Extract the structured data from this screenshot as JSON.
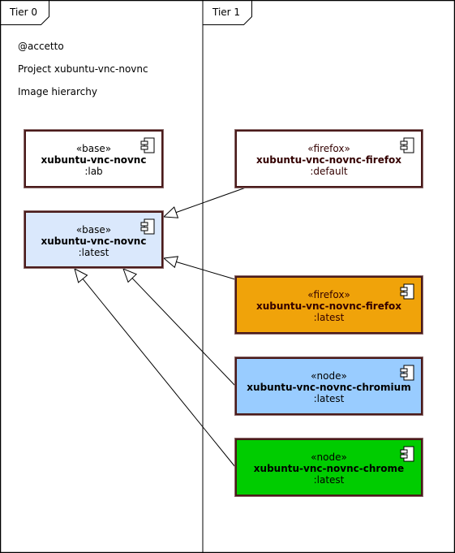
{
  "lanes": [
    {
      "label": "Tier 0"
    },
    {
      "label": "Tier 1"
    }
  ],
  "notes": [
    "@accetto",
    "Project xubuntu-vnc-novnc",
    "Image hierarchy"
  ],
  "components": [
    {
      "id": "base-lab",
      "stereotype": "«base»",
      "name": "xubuntu-vnc-novnc",
      "tag": ":lab",
      "fill": "#ffffff",
      "text_color": "#000000"
    },
    {
      "id": "base-latest",
      "stereotype": "«base»",
      "name": "xubuntu-vnc-novnc",
      "tag": ":latest",
      "fill": "#dae8fc",
      "text_color": "#000000"
    },
    {
      "id": "firefox-default",
      "stereotype": "«firefox»",
      "name": "xubuntu-vnc-novnc-firefox",
      "tag": ":default",
      "fill": "#ffffff",
      "text_color": "#330000"
    },
    {
      "id": "firefox-latest",
      "stereotype": "«firefox»",
      "name": "xubuntu-vnc-novnc-firefox",
      "tag": ":latest",
      "fill": "#f0a30a",
      "text_color": "#330000"
    },
    {
      "id": "chromium-latest",
      "stereotype": "«node»",
      "name": "xubuntu-vnc-novnc-chromium",
      "tag": ":latest",
      "fill": "#99ccff",
      "text_color": "#000000"
    },
    {
      "id": "chrome-latest",
      "stereotype": "«node»",
      "name": "xubuntu-vnc-novnc-chrome",
      "tag": ":latest",
      "fill": "#00cc00",
      "text_color": "#000000"
    }
  ],
  "edges": [
    {
      "from": "firefox-default",
      "to": "base-latest",
      "type": "generalization"
    },
    {
      "from": "firefox-latest",
      "to": "base-latest",
      "type": "generalization"
    },
    {
      "from": "chromium-latest",
      "to": "base-latest",
      "type": "generalization"
    },
    {
      "from": "chrome-latest",
      "to": "base-latest",
      "type": "generalization"
    }
  ]
}
